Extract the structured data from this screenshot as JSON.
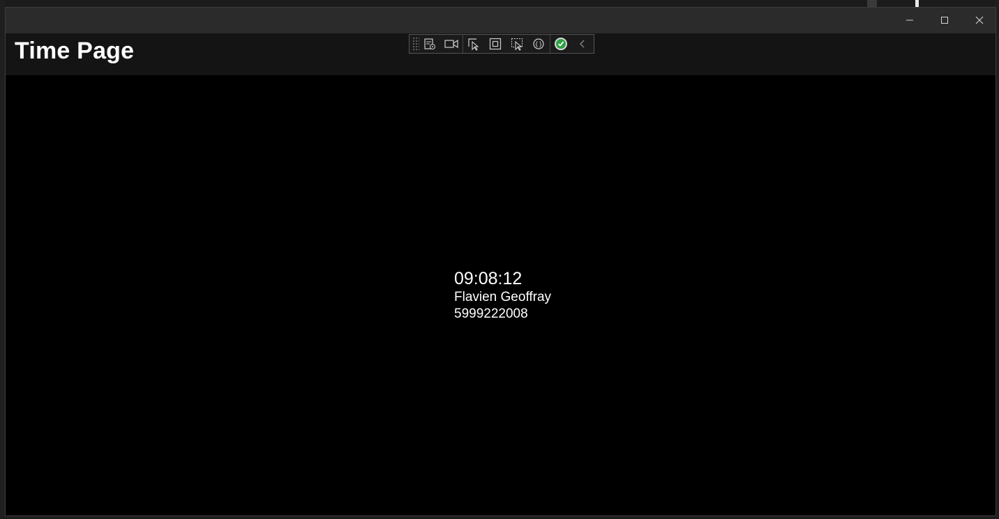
{
  "window": {
    "title": "Time Page",
    "caption": {
      "minimize": "minimize",
      "maximize": "maximize",
      "close": "close"
    }
  },
  "debug_toolbar": {
    "items": [
      {
        "icon": "live-visual-tree-icon"
      },
      {
        "icon": "video-record-icon"
      },
      {
        "icon": "select-element-icon"
      },
      {
        "icon": "display-layout-adorners-icon"
      },
      {
        "icon": "track-focused-element-icon"
      },
      {
        "icon": "hot-reload-icon"
      },
      {
        "icon": "status-ok-icon",
        "color": "#2ea043"
      },
      {
        "icon": "collapse-chevron-icon"
      }
    ]
  },
  "content": {
    "time": "09:08:12",
    "name": "Flavien Geoffray",
    "phone": "5999222008"
  },
  "colors": {
    "titlebar": "#2b2b2b",
    "header": "#141414",
    "content_bg": "#000000",
    "text": "#ffffff"
  }
}
